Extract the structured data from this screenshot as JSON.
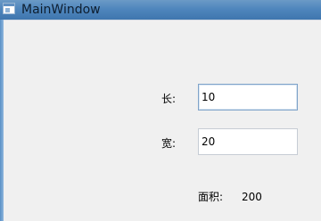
{
  "window": {
    "title": "MainWindow"
  },
  "form": {
    "length_label": "长:",
    "length_value": "10",
    "width_label": "宽:",
    "width_value": "20",
    "area_label": "面积:",
    "area_value": "200"
  }
}
